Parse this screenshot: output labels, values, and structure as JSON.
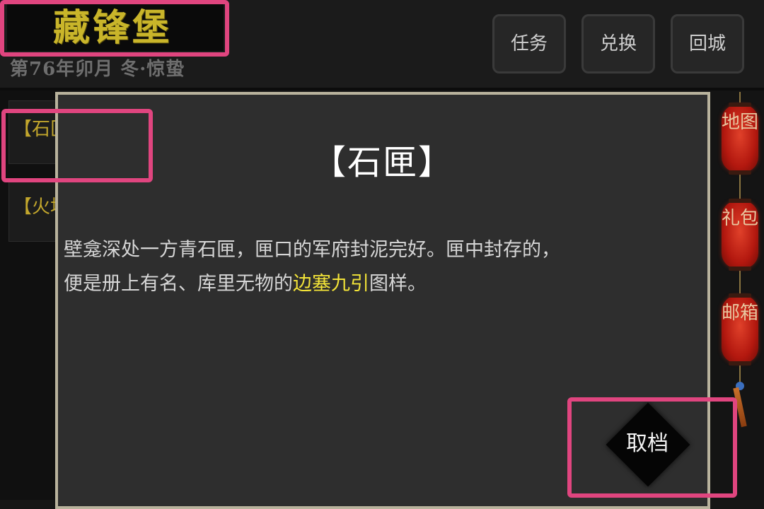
{
  "header": {
    "location_title": "藏锋堡",
    "date_text": "第76年卯月 冬·惊蛰",
    "buttons": {
      "quest": "任务",
      "exchange": "兑换",
      "return_city": "回城"
    }
  },
  "list": {
    "items": [
      "【石匣】",
      "【火坑】"
    ]
  },
  "side_menu": {
    "map": "地图",
    "gift": "礼包",
    "mail": "邮箱"
  },
  "dialog": {
    "title": "【石匣】",
    "body_line1": "壁龛深处一方青石匣，匣口的军府封泥完好。匣中封存的，",
    "body_line2_pre": "便是册上有名、库里无物的",
    "body_line2_highlight": "边塞九引",
    "body_line2_post": "图样。",
    "confirm_label": "取档"
  },
  "colors": {
    "title_gold": "#c9b52a",
    "item_gold": "#c2a62c",
    "highlight_yellow": "#f2e338",
    "annotation_pink": "#e0457f",
    "lantern_red": "#b3180f"
  }
}
